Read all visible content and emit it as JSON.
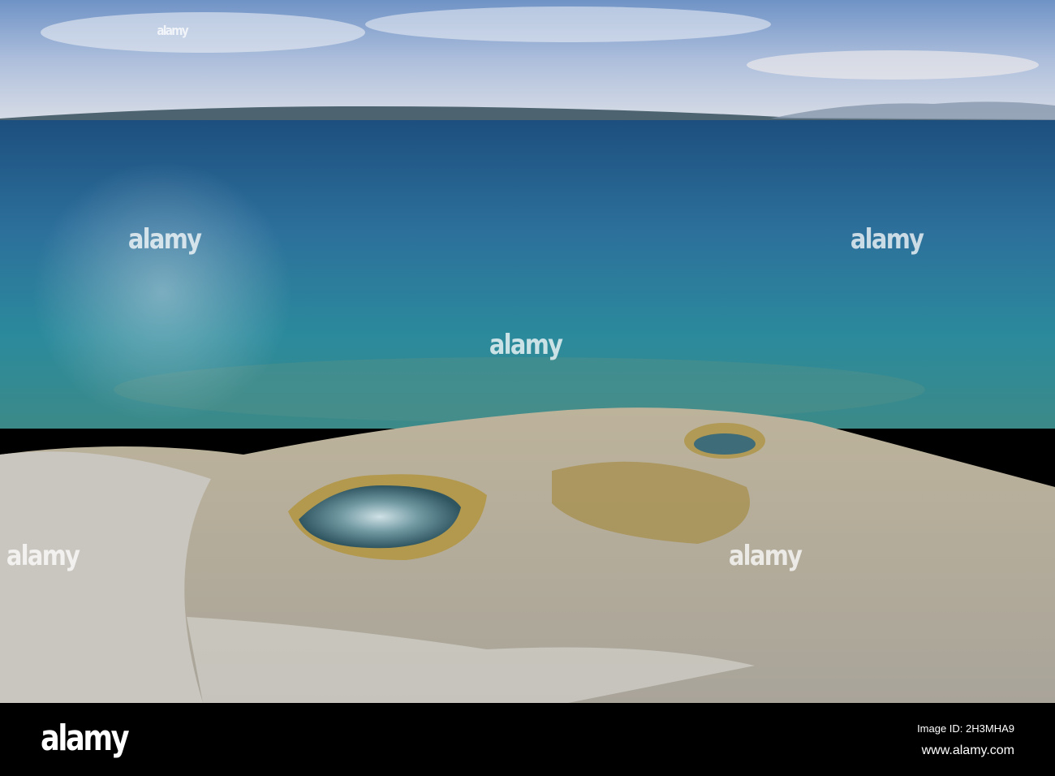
{
  "photo": {
    "subject": "Yellowstone Lake shoreline with geyser pools",
    "watermark": "alamy"
  },
  "footer": {
    "logo": "alamy",
    "image_id": "Image ID: 2H3MHA9",
    "url": "www.alamy.com"
  }
}
